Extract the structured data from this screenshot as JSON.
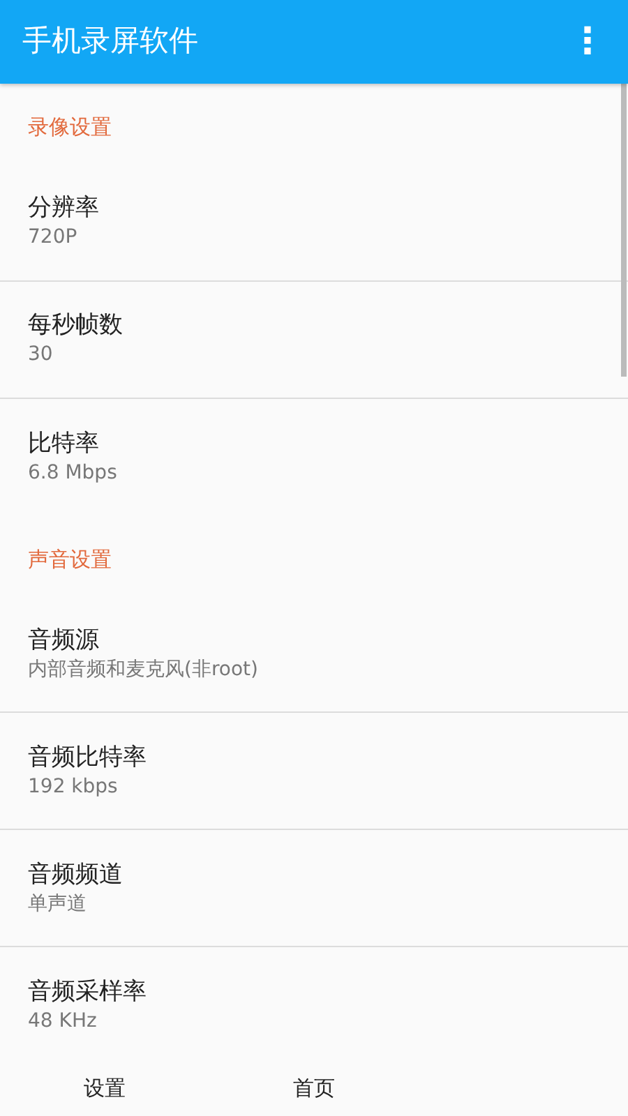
{
  "app_bar": {
    "title": "手机录屏软件",
    "menu_icon": "⋮"
  },
  "sections": [
    {
      "title": "录像设置",
      "items": [
        {
          "title": "分辨率",
          "summary": "720P"
        },
        {
          "title": "每秒帧数",
          "summary": "30"
        },
        {
          "title": "比特率",
          "summary": "6.8 Mbps"
        }
      ]
    },
    {
      "title": "声音设置",
      "items": [
        {
          "title": "音频源",
          "summary": "内部音频和麦克风(非root)"
        },
        {
          "title": "音频比特率",
          "summary": "192 kbps"
        },
        {
          "title": "音频频道",
          "summary": "单声道"
        },
        {
          "title": "音频采样率",
          "summary": "48 KHz"
        }
      ]
    }
  ],
  "bottom_nav": [
    {
      "label": "设置"
    },
    {
      "label": "首页"
    }
  ]
}
